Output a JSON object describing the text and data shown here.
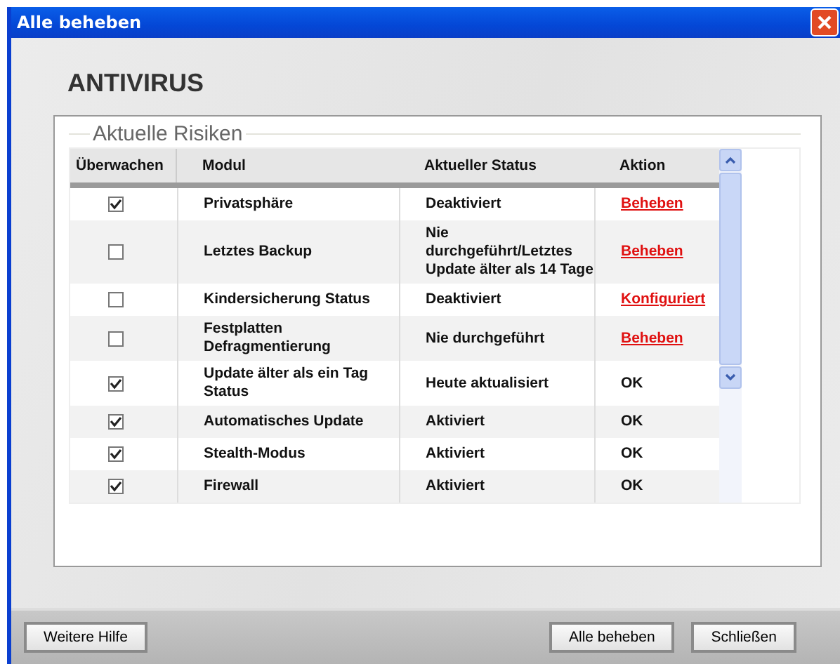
{
  "window": {
    "title": "Alle beheben"
  },
  "heading": "ANTIVIRUS",
  "group": {
    "title": "Aktuelle Risiken"
  },
  "table": {
    "columns": [
      "Überwachen",
      "Modul",
      "Aktueller Status",
      "Aktion"
    ],
    "rows": [
      {
        "checked": true,
        "module": "Privatsphäre",
        "status": "Deaktiviert",
        "action": {
          "kind": "link",
          "text": "Beheben"
        }
      },
      {
        "checked": false,
        "module": "Letztes Backup",
        "status": "Nie durchgeführt/Letztes Update älter als 14 Tage",
        "action": {
          "kind": "link",
          "text": "Beheben"
        }
      },
      {
        "checked": false,
        "module": "Kindersicherung Status",
        "status": "Deaktiviert",
        "action": {
          "kind": "link",
          "text": "Konfiguriert"
        }
      },
      {
        "checked": false,
        "module": "Festplatten Defragmentierung",
        "status": "Nie durchgeführt",
        "action": {
          "kind": "link",
          "text": "Beheben"
        }
      },
      {
        "checked": true,
        "module": "Update älter als ein Tag Status",
        "status": "Heute aktualisiert",
        "action": {
          "kind": "text",
          "text": "OK"
        }
      },
      {
        "checked": true,
        "module": "Automatisches Update",
        "status": "Aktiviert",
        "action": {
          "kind": "text",
          "text": "OK"
        }
      },
      {
        "checked": true,
        "module": "Stealth-Modus",
        "status": "Aktiviert",
        "action": {
          "kind": "text",
          "text": "OK"
        }
      },
      {
        "checked": true,
        "module": "Firewall",
        "status": "Aktiviert",
        "action": {
          "kind": "text",
          "text": "OK"
        }
      }
    ]
  },
  "buttons": {
    "left": [
      "Weitere Hilfe"
    ],
    "right": [
      "Alle beheben",
      "Schließen"
    ]
  }
}
